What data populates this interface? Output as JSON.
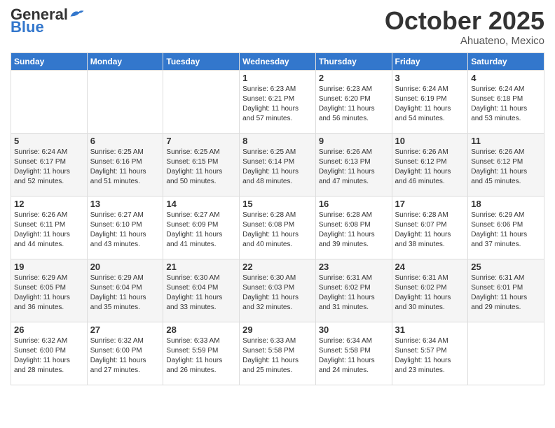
{
  "header": {
    "logo_general": "General",
    "logo_blue": "Blue",
    "month": "October 2025",
    "location": "Ahuateno, Mexico"
  },
  "days_of_week": [
    "Sunday",
    "Monday",
    "Tuesday",
    "Wednesday",
    "Thursday",
    "Friday",
    "Saturday"
  ],
  "weeks": [
    [
      {
        "day": "",
        "info": ""
      },
      {
        "day": "",
        "info": ""
      },
      {
        "day": "",
        "info": ""
      },
      {
        "day": "1",
        "info": "Sunrise: 6:23 AM\nSunset: 6:21 PM\nDaylight: 11 hours\nand 57 minutes."
      },
      {
        "day": "2",
        "info": "Sunrise: 6:23 AM\nSunset: 6:20 PM\nDaylight: 11 hours\nand 56 minutes."
      },
      {
        "day": "3",
        "info": "Sunrise: 6:24 AM\nSunset: 6:19 PM\nDaylight: 11 hours\nand 54 minutes."
      },
      {
        "day": "4",
        "info": "Sunrise: 6:24 AM\nSunset: 6:18 PM\nDaylight: 11 hours\nand 53 minutes."
      }
    ],
    [
      {
        "day": "5",
        "info": "Sunrise: 6:24 AM\nSunset: 6:17 PM\nDaylight: 11 hours\nand 52 minutes."
      },
      {
        "day": "6",
        "info": "Sunrise: 6:25 AM\nSunset: 6:16 PM\nDaylight: 11 hours\nand 51 minutes."
      },
      {
        "day": "7",
        "info": "Sunrise: 6:25 AM\nSunset: 6:15 PM\nDaylight: 11 hours\nand 50 minutes."
      },
      {
        "day": "8",
        "info": "Sunrise: 6:25 AM\nSunset: 6:14 PM\nDaylight: 11 hours\nand 48 minutes."
      },
      {
        "day": "9",
        "info": "Sunrise: 6:26 AM\nSunset: 6:13 PM\nDaylight: 11 hours\nand 47 minutes."
      },
      {
        "day": "10",
        "info": "Sunrise: 6:26 AM\nSunset: 6:12 PM\nDaylight: 11 hours\nand 46 minutes."
      },
      {
        "day": "11",
        "info": "Sunrise: 6:26 AM\nSunset: 6:12 PM\nDaylight: 11 hours\nand 45 minutes."
      }
    ],
    [
      {
        "day": "12",
        "info": "Sunrise: 6:26 AM\nSunset: 6:11 PM\nDaylight: 11 hours\nand 44 minutes."
      },
      {
        "day": "13",
        "info": "Sunrise: 6:27 AM\nSunset: 6:10 PM\nDaylight: 11 hours\nand 43 minutes."
      },
      {
        "day": "14",
        "info": "Sunrise: 6:27 AM\nSunset: 6:09 PM\nDaylight: 11 hours\nand 41 minutes."
      },
      {
        "day": "15",
        "info": "Sunrise: 6:28 AM\nSunset: 6:08 PM\nDaylight: 11 hours\nand 40 minutes."
      },
      {
        "day": "16",
        "info": "Sunrise: 6:28 AM\nSunset: 6:08 PM\nDaylight: 11 hours\nand 39 minutes."
      },
      {
        "day": "17",
        "info": "Sunrise: 6:28 AM\nSunset: 6:07 PM\nDaylight: 11 hours\nand 38 minutes."
      },
      {
        "day": "18",
        "info": "Sunrise: 6:29 AM\nSunset: 6:06 PM\nDaylight: 11 hours\nand 37 minutes."
      }
    ],
    [
      {
        "day": "19",
        "info": "Sunrise: 6:29 AM\nSunset: 6:05 PM\nDaylight: 11 hours\nand 36 minutes."
      },
      {
        "day": "20",
        "info": "Sunrise: 6:29 AM\nSunset: 6:04 PM\nDaylight: 11 hours\nand 35 minutes."
      },
      {
        "day": "21",
        "info": "Sunrise: 6:30 AM\nSunset: 6:04 PM\nDaylight: 11 hours\nand 33 minutes."
      },
      {
        "day": "22",
        "info": "Sunrise: 6:30 AM\nSunset: 6:03 PM\nDaylight: 11 hours\nand 32 minutes."
      },
      {
        "day": "23",
        "info": "Sunrise: 6:31 AM\nSunset: 6:02 PM\nDaylight: 11 hours\nand 31 minutes."
      },
      {
        "day": "24",
        "info": "Sunrise: 6:31 AM\nSunset: 6:02 PM\nDaylight: 11 hours\nand 30 minutes."
      },
      {
        "day": "25",
        "info": "Sunrise: 6:31 AM\nSunset: 6:01 PM\nDaylight: 11 hours\nand 29 minutes."
      }
    ],
    [
      {
        "day": "26",
        "info": "Sunrise: 6:32 AM\nSunset: 6:00 PM\nDaylight: 11 hours\nand 28 minutes."
      },
      {
        "day": "27",
        "info": "Sunrise: 6:32 AM\nSunset: 6:00 PM\nDaylight: 11 hours\nand 27 minutes."
      },
      {
        "day": "28",
        "info": "Sunrise: 6:33 AM\nSunset: 5:59 PM\nDaylight: 11 hours\nand 26 minutes."
      },
      {
        "day": "29",
        "info": "Sunrise: 6:33 AM\nSunset: 5:58 PM\nDaylight: 11 hours\nand 25 minutes."
      },
      {
        "day": "30",
        "info": "Sunrise: 6:34 AM\nSunset: 5:58 PM\nDaylight: 11 hours\nand 24 minutes."
      },
      {
        "day": "31",
        "info": "Sunrise: 6:34 AM\nSunset: 5:57 PM\nDaylight: 11 hours\nand 23 minutes."
      },
      {
        "day": "",
        "info": ""
      }
    ]
  ]
}
